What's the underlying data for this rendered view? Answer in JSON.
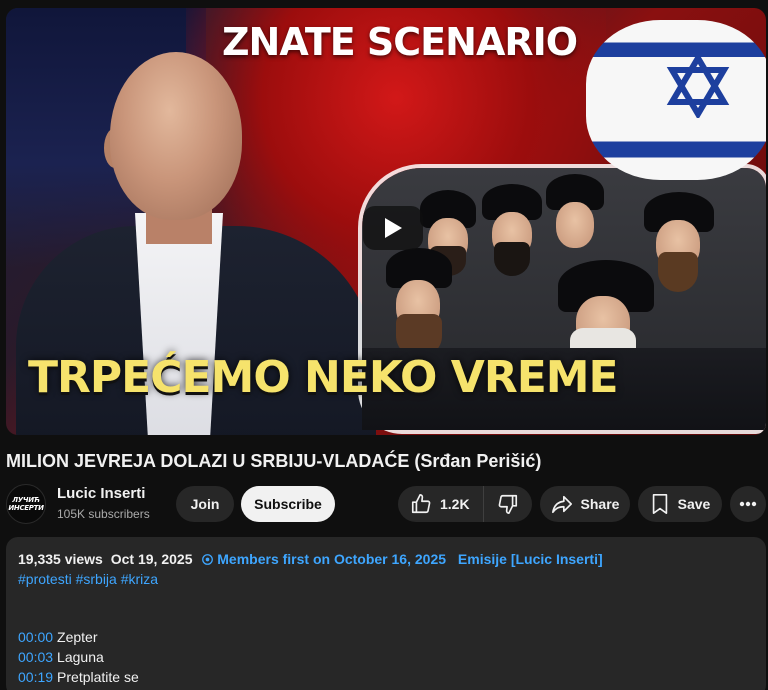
{
  "thumbnail": {
    "top_text": "ZNATE SCENARIO",
    "bottom_text": "TRPEĆEMO NEKO VREME"
  },
  "video": {
    "title": "MILION JEVREJA DOLAZI U SRBIJU-VLADAĆE (Srđan Perišić)"
  },
  "channel": {
    "avatar_text": "ЛУЧИЋ ИНСЕРТИ",
    "name": "Lucic Inserti",
    "subscribers": "105K subscribers"
  },
  "actions": {
    "join": "Join",
    "subscribe": "Subscribe",
    "likes": "1.2K",
    "share": "Share",
    "save": "Save"
  },
  "description": {
    "views": "19,335 views",
    "date": "Oct 19, 2025",
    "members_first": "Members first on October 16, 2025",
    "playlist": "Emisije [Lucic Inserti]",
    "tags": "#protesti #srbija #kriza",
    "chapters": [
      {
        "time": "00:00",
        "label": "Zepter"
      },
      {
        "time": "00:03",
        "label": "Laguna"
      },
      {
        "time": "00:19",
        "label": "Pretplatite se"
      }
    ]
  },
  "colors": {
    "background": "#0f0f0f",
    "surface": "#272727",
    "link": "#3ea6ff",
    "thumbnail_yellow": "#f6e36c"
  }
}
